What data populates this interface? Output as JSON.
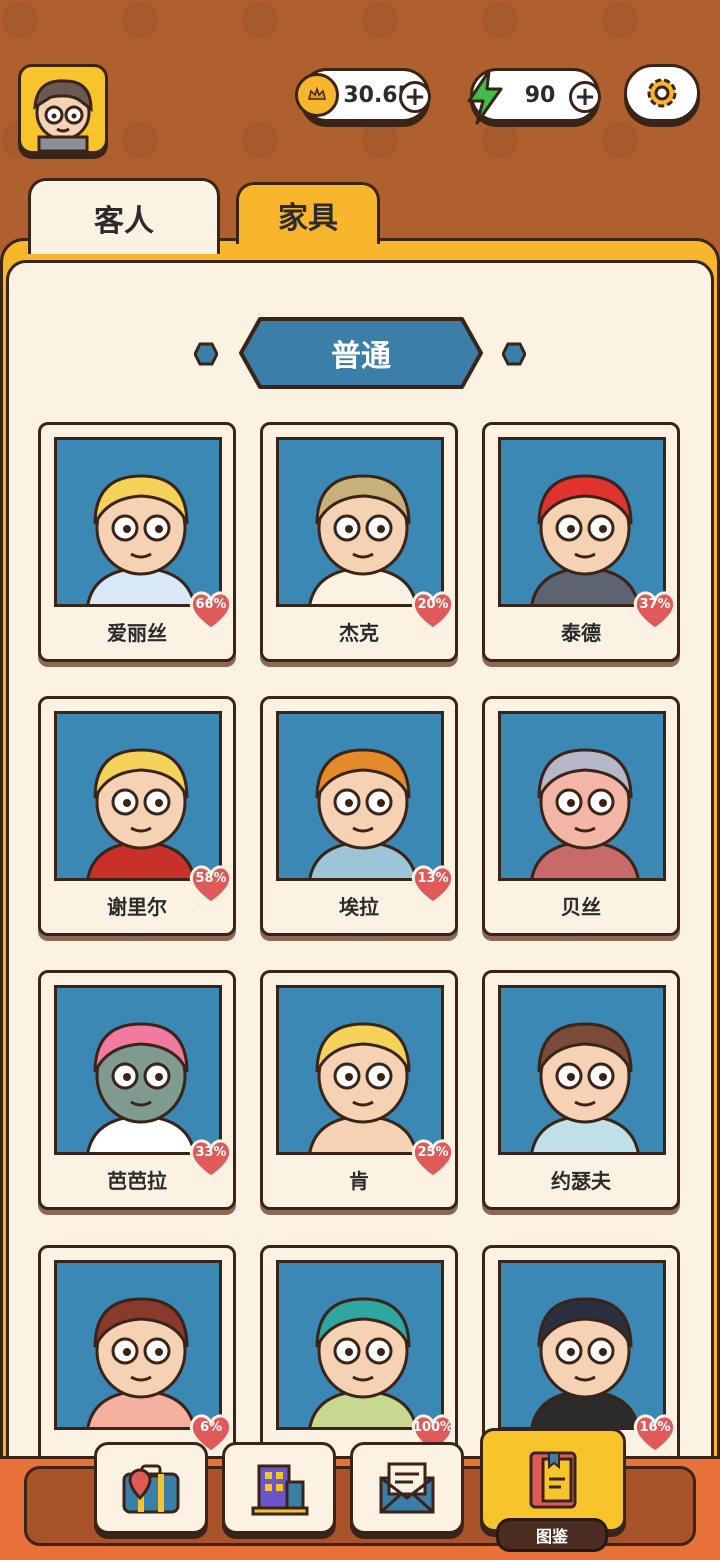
{
  "header": {
    "coins": "30.6K",
    "energy": "90"
  },
  "tabs": [
    {
      "label": "客人",
      "active": false
    },
    {
      "label": "家具",
      "active": true
    }
  ],
  "section": {
    "title": "普通"
  },
  "colors": {
    "accent": "#f7b62b",
    "portrait_bg": "#3b88b5",
    "banner": "#3b7fa8",
    "heart": "#e05a5a",
    "outline": "#3a2418"
  },
  "characters": [
    {
      "name": "爱丽丝",
      "affinity": "66%"
    },
    {
      "name": "杰克",
      "affinity": "20%"
    },
    {
      "name": "泰德",
      "affinity": "37%"
    },
    {
      "name": "谢里尔",
      "affinity": "58%"
    },
    {
      "name": "埃拉",
      "affinity": "13%"
    },
    {
      "name": "贝丝",
      "affinity": ""
    },
    {
      "name": "芭芭拉",
      "affinity": "33%"
    },
    {
      "name": "肯",
      "affinity": "25%"
    },
    {
      "name": "约瑟夫",
      "affinity": ""
    },
    {
      "name": "",
      "affinity": "6%"
    },
    {
      "name": "",
      "affinity": "100%"
    },
    {
      "name": "",
      "affinity": "16%"
    }
  ],
  "bottom_nav": [
    {
      "icon": "suitcase-icon"
    },
    {
      "icon": "building-icon"
    },
    {
      "icon": "mail-icon"
    },
    {
      "icon": "book-icon",
      "label": "图鉴",
      "active": true
    }
  ]
}
